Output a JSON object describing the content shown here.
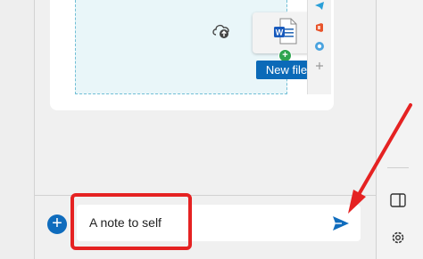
{
  "dropzone": {
    "new_file_label": "New file",
    "add_badge": "+",
    "file_icon": "word-document-icon",
    "upload_icon": "cloud-upload-icon"
  },
  "composer": {
    "add_button_label": "+",
    "message_text": "A note to self",
    "send_icon": "send-icon"
  },
  "sidebar": {
    "icons": [
      "split-pane-icon",
      "gear-icon"
    ]
  },
  "colors": {
    "accent": "#0f6cbd",
    "highlight": "#e52222",
    "badge": "#2ea44f"
  }
}
